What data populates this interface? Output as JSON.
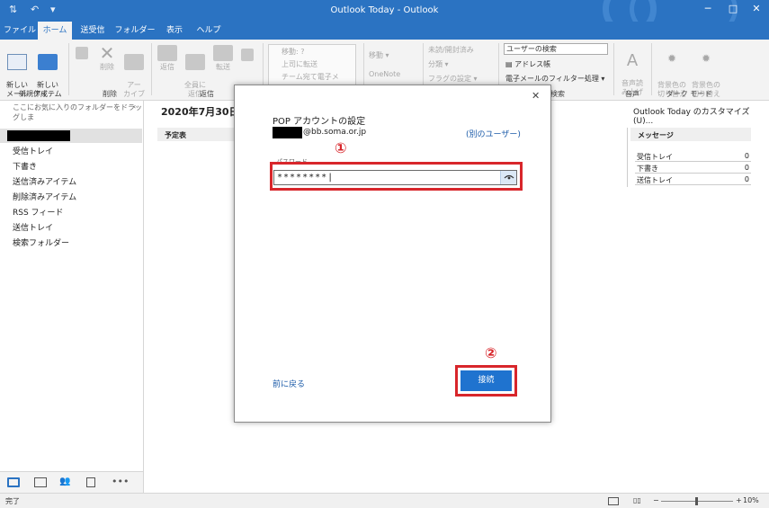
{
  "window": {
    "title": "Outlook Today  -  Outlook",
    "minimize": "─",
    "restore": "□",
    "close": "✕"
  },
  "tabs": [
    "ファイル",
    "ホーム",
    "送受信",
    "フォルダー",
    "表示",
    "ヘルプ"
  ],
  "ribbon": {
    "new_mail": "新しい\nメール",
    "new_items": "新しい\nアイテム ▾",
    "group_new": "新規作成",
    "delete": "削除",
    "archive": "アー\nカイブ",
    "group_delete": "削除",
    "reply": "返信",
    "reply_all": "全員に\n返信",
    "forward": "転送",
    "group_reply": "返信",
    "quick_move": "移動: ?",
    "quick_manager": "上司に転送",
    "quick_team": "チーム宛て電子メ",
    "move": "移動 ▾",
    "onenote": "OneNote",
    "unread_read": "未読/開封済み",
    "categorize": "分類 ▾",
    "followup": "フラグの設定 ▾",
    "search_people": "ユーザーの検索",
    "address_book": "アドレス帳",
    "filter_email": "電子メールのフィルター処理 ▾",
    "group_find": "検索",
    "read_aloud": "音声読\nみ上げ",
    "group_speech": "音声",
    "switch_bg": "背景色の\n切り替え",
    "switch_bg2": "背景色の\n切り替え",
    "group_dark": "ダーク モード"
  },
  "left_pane": {
    "favorites_hint": "ここにお気に入りのフォルダーをドラッグしま",
    "folders": [
      "受信トレイ",
      "下書き",
      "送信済みアイテム",
      "削除済みアイテム",
      "RSS フィード",
      "送信トレイ",
      "検索フォルダー"
    ]
  },
  "main": {
    "date": "2020年7月30日",
    "customize": "Outlook Today のカスタマイズ(U)...",
    "calendar_header": "予定表",
    "messages_header": "メッセージ",
    "messages": [
      {
        "label": "受信トレイ",
        "count": "0"
      },
      {
        "label": "下書き",
        "count": "0"
      },
      {
        "label": "送信トレイ",
        "count": "0"
      }
    ]
  },
  "dialog": {
    "title": "POP アカウントの設定",
    "email": "@bb.soma.or.jp",
    "other_user": "(別のユーザー)",
    "step1": "①",
    "password_label": "パスワード",
    "password_value": "********|",
    "step2": "②",
    "back": "前に戻る",
    "connect": "接続",
    "close": "✕"
  },
  "status": {
    "left": "完了",
    "zoom": "10%"
  },
  "colors": {
    "accent": "#2b73c2",
    "highlight_red": "#d8262b",
    "connect_button": "#1f73cf"
  }
}
